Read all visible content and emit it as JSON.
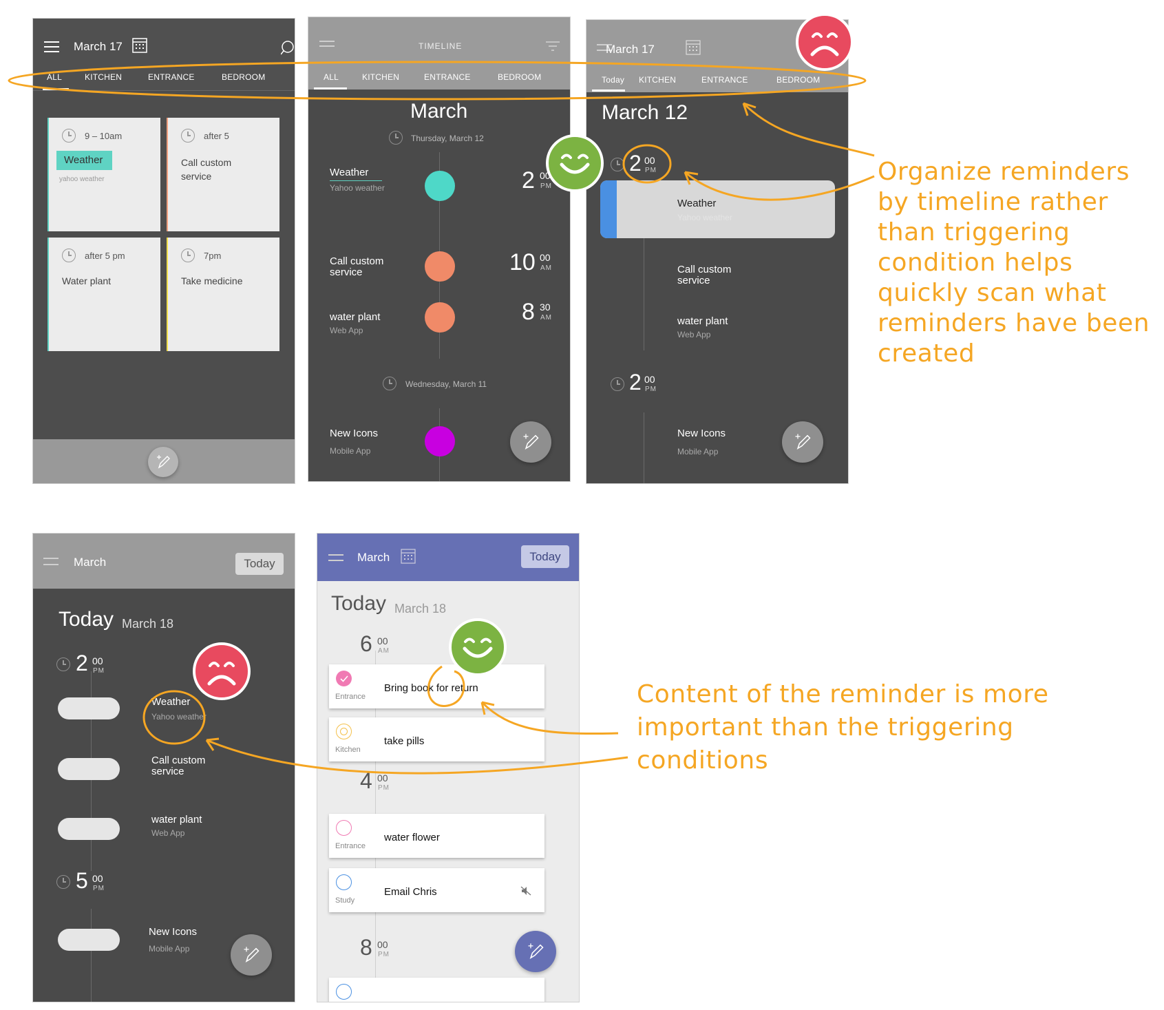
{
  "screen1": {
    "title": "March 17",
    "tabs": [
      "ALL",
      "KITCHEN",
      "ENTRANCE",
      "BEDROOM"
    ],
    "cards": [
      {
        "time": "9 – 10am",
        "title": "Weather",
        "subtitle": "yahoo weather",
        "accent": "#5fd3c3"
      },
      {
        "time": "after 5",
        "title": "Call custom\nservice",
        "accent": "#f0a080"
      },
      {
        "time": "after 5 pm",
        "title": "Water plant",
        "accent": "#5fd3c3"
      },
      {
        "time": "7pm",
        "title": "Take medicine",
        "accent": "#f2e04c"
      }
    ]
  },
  "screen2": {
    "title": "TIMELINE",
    "tabs": [
      "ALL",
      "KITCHEN",
      "ENTRANCE",
      "BEDROOM"
    ],
    "month": "March",
    "day1": "Thursday, March 12",
    "day2": "Wednesday, March 11",
    "items": [
      {
        "title": "Weather",
        "subtitle": "Yahoo weather",
        "hour": "2",
        "min": "00",
        "ampm": "PM",
        "color": "#4ed8c8"
      },
      {
        "title": "Call custom\nservice",
        "subtitle": "",
        "hour": "10",
        "min": "00",
        "ampm": "AM",
        "color": "#f08a68"
      },
      {
        "title": "water plant",
        "subtitle": "Web App",
        "hour": "8",
        "min": "30",
        "ampm": "AM",
        "color": "#f08a68"
      },
      {
        "title": "New Icons",
        "subtitle": "Mobile App",
        "color": "#c800e0"
      }
    ]
  },
  "screen3": {
    "title": "March 17",
    "tabs": [
      "Today",
      "KITCHEN",
      "ENTRANCE",
      "BEDROOM"
    ],
    "heading": "March 12",
    "time1": {
      "hour": "2",
      "min": "00",
      "ampm": "PM"
    },
    "time2": {
      "hour": "2",
      "min": "00",
      "ampm": "PM"
    },
    "items": [
      {
        "title": "Weather",
        "subtitle": "Yahoo weather"
      },
      {
        "title": "Call custom\nservice",
        "subtitle": ""
      },
      {
        "title": "water plant",
        "subtitle": "Web App"
      },
      {
        "title": "New Icons",
        "subtitle": "Mobile App"
      }
    ]
  },
  "screen4": {
    "title": "March",
    "today_button": "Today",
    "heading_day": "Today",
    "heading_date": "March 18",
    "time1": {
      "hour": "2",
      "min": "00",
      "ampm": "PM"
    },
    "time2": {
      "hour": "5",
      "min": "00",
      "ampm": "PM"
    },
    "items": [
      {
        "title": "Weather",
        "subtitle": "Yahoo weather"
      },
      {
        "title": "Call custom\nservice",
        "subtitle": ""
      },
      {
        "title": "water plant",
        "subtitle": "Web App"
      },
      {
        "title": "New Icons",
        "subtitle": "Mobile App"
      }
    ]
  },
  "screen5": {
    "title": "March",
    "today_button": "Today",
    "heading_day": "Today",
    "heading_date": "March 18",
    "accent": "#6670b4",
    "times": [
      {
        "hour": "6",
        "min": "00",
        "ampm": "AM"
      },
      {
        "hour": "4",
        "min": "00",
        "ampm": "PM"
      },
      {
        "hour": "8",
        "min": "00",
        "ampm": "PM"
      }
    ],
    "items": [
      {
        "title": "Bring book for return",
        "location": "Entrance",
        "icon": "check-circle-icon"
      },
      {
        "title": "take pills",
        "location": "Kitchen",
        "icon": "alarm-icon"
      },
      {
        "title": "water flower",
        "location": "Entrance",
        "icon": "circle-icon"
      },
      {
        "title": "Email Chris",
        "location": "Study",
        "icon": "circle-icon"
      }
    ]
  },
  "annotations": {
    "note1": "Organize reminders by timeline rather than triggering condition helps quickly scan what reminders have been created",
    "note2": "Content of the reminder is more important than the triggering conditions",
    "color": "#f5a623",
    "happy_color": "#7cb342",
    "sad_color": "#e84a5f"
  }
}
